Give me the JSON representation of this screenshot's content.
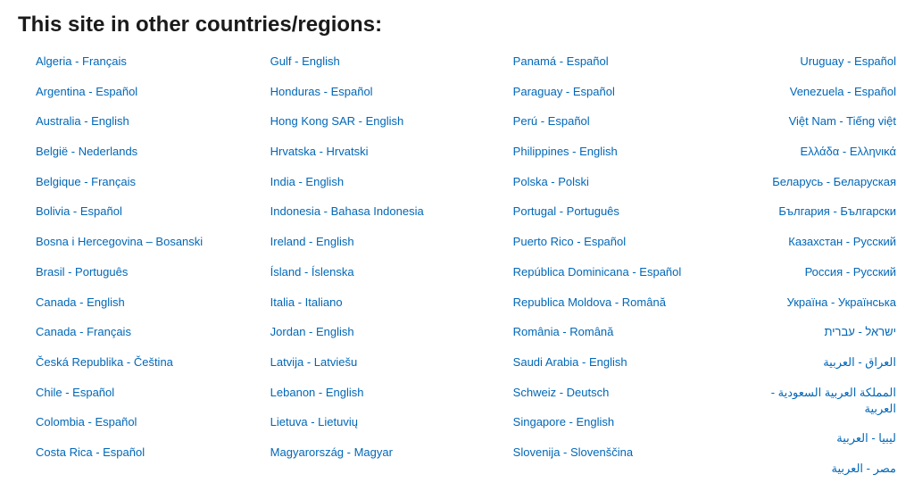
{
  "heading": "This site in other countries/regions:",
  "columns": [
    [
      "Algeria - Français",
      "Argentina - Español",
      "Australia - English",
      "België - Nederlands",
      "Belgique - Français",
      "Bolivia - Español",
      "Bosna i Hercegovina – Bosanski",
      "Brasil - Português",
      "Canada - English",
      "Canada - Français",
      "Česká Republika - Čeština",
      "Chile - Español",
      "Colombia - Español",
      "Costa Rica - Español"
    ],
    [
      "Gulf - English",
      "Honduras - Español",
      "Hong Kong SAR - English",
      "Hrvatska - Hrvatski",
      "India - English",
      "Indonesia - Bahasa Indonesia",
      "Ireland - English",
      "Ísland - Íslenska",
      "Italia - Italiano",
      "Jordan - English",
      "Latvija - Latviešu",
      "Lebanon - English",
      "Lietuva - Lietuvių",
      "Magyarország - Magyar"
    ],
    [
      "Panamá - Español",
      "Paraguay - Español",
      "Perú - Español",
      "Philippines - English",
      "Polska - Polski",
      "Portugal - Português",
      "Puerto Rico - Español",
      "República Dominicana - Español",
      "Republica Moldova - Română",
      "România - Română",
      "Saudi Arabia - English",
      "Schweiz - Deutsch",
      "Singapore - English",
      "Slovenija - Slovenščina"
    ],
    [
      "Uruguay - Español",
      "Venezuela - Español",
      "Việt Nam - Tiếng việt",
      "Ελλάδα - Ελληνικά",
      "Беларусь - Беларуская",
      "България - Български",
      "Казахстан - Русский",
      "Россия - Русский",
      "Україна - Українська",
      "ישראל - עברית",
      "العراق - العربية",
      "المملكة العربية السعودية - العربية",
      "ليبيا - العربية",
      "مصر - العربية"
    ]
  ],
  "rtl_start_index": 9
}
